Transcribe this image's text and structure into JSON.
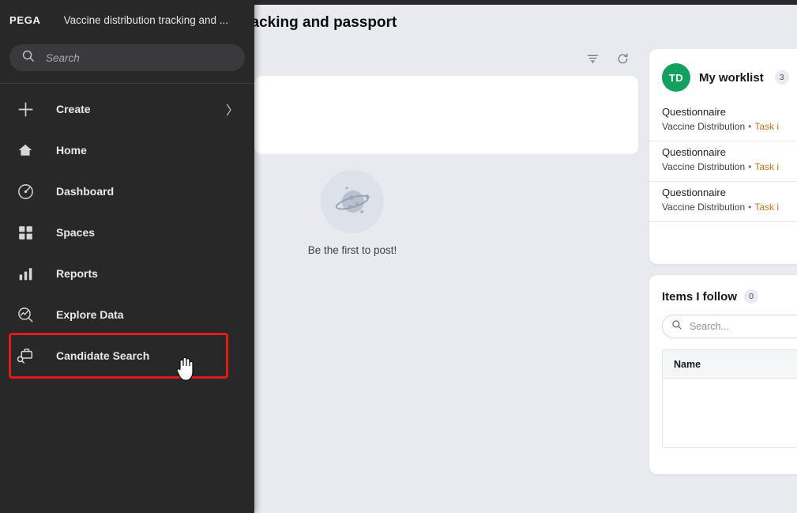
{
  "app": {
    "brand": "PEGA",
    "app_name": "Vaccine distribution tracking and ...",
    "page_title": "Vaccine distribution tracking and passport"
  },
  "nav_search": {
    "placeholder": "Search",
    "value": "",
    "icon": "search-icon"
  },
  "sidebar": {
    "items": [
      {
        "label": "Create",
        "icon": "plus-icon",
        "chevron": "〉",
        "highlighted": false
      },
      {
        "label": "Home",
        "icon": "home-icon",
        "chevron": "",
        "highlighted": false
      },
      {
        "label": "Dashboard",
        "icon": "dashboard-gauge-icon",
        "chevron": "",
        "highlighted": false
      },
      {
        "label": "Spaces",
        "icon": "grid-squares-icon",
        "chevron": "",
        "highlighted": false
      },
      {
        "label": "Reports",
        "icon": "bar-chart-icon",
        "chevron": "",
        "highlighted": false
      },
      {
        "label": "Explore Data",
        "icon": "explore-data-icon",
        "chevron": "",
        "highlighted": false
      },
      {
        "label": "Candidate Search",
        "icon": "briefcase-search-icon",
        "chevron": "",
        "highlighted": true
      }
    ],
    "highlight_color": "#e01b1b"
  },
  "feed": {
    "tools": [
      {
        "name": "filter-icon",
        "label": "Filter"
      },
      {
        "name": "refresh-icon",
        "label": "Refresh"
      }
    ],
    "empty_state": {
      "illustration": "planet-icon",
      "label": "Be the first to post!"
    }
  },
  "worklist": {
    "avatar_initials": "TD",
    "avatar_color": "#12a05e",
    "title": "My worklist",
    "count": "3",
    "items": [
      {
        "name": "Questionnaire",
        "case": "Vaccine Distribution",
        "separator": "•",
        "task": "Task i"
      },
      {
        "name": "Questionnaire",
        "case": "Vaccine Distribution",
        "separator": "•",
        "task": "Task i"
      },
      {
        "name": "Questionnaire",
        "case": "Vaccine Distribution",
        "separator": "•",
        "task": "Task i"
      }
    ]
  },
  "items_i_follow": {
    "title": "Items I follow",
    "count": "0",
    "search": {
      "placeholder": "Search...",
      "value": "",
      "icon": "search-icon"
    },
    "table": {
      "columns": [
        "Name"
      ],
      "rows": []
    }
  }
}
